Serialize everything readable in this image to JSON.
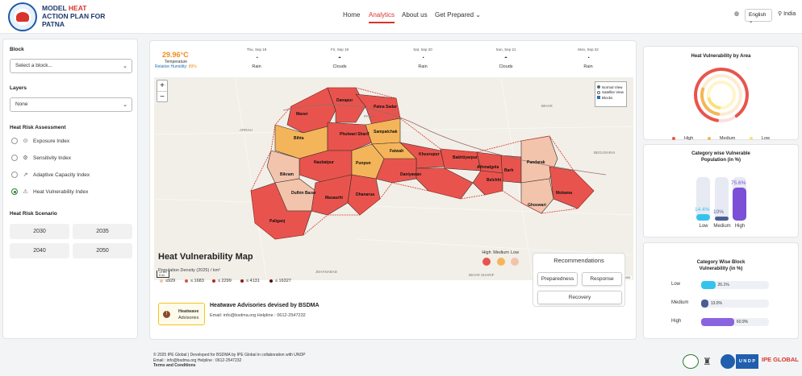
{
  "header": {
    "logo_line1_a": "MODEL ",
    "logo_line1_b": "HEAT",
    "logo_line2": "ACTION PLAN FOR",
    "logo_line3": "PATNA",
    "nav": [
      "Home",
      "Analytics",
      "About us",
      "Get Prepared"
    ],
    "active_nav": "Analytics",
    "language": "English",
    "country": "India"
  },
  "sidebar": {
    "block_label": "Block",
    "block_placeholder": "Select a block...",
    "layers_label": "Layers",
    "layers_value": "None",
    "assessment_label": "Heat Risk Assessment",
    "assessment_options": [
      "Exposure Index",
      "Sensitivity Index",
      "Adaptive Capacity Index",
      "Heat Vulnerability Index"
    ],
    "assessment_selected": "Heat Vulnerability Index",
    "scenario_label": "Heat Risk Scenario",
    "years": [
      "2030",
      "2035",
      "2040",
      "2050"
    ]
  },
  "weather": {
    "temperature": "29.96°C",
    "temperature_label": "Temperature",
    "humidity_label": "Relative Humidity:",
    "humidity_value": "89%",
    "forecast": [
      {
        "date": "Thu, Sep 18",
        "cond": "Rain"
      },
      {
        "date": "Fri, Sep 19",
        "cond": "Clouds"
      },
      {
        "date": "Sat, Sep 20",
        "cond": "Rain"
      },
      {
        "date": "Sun, Sep 21",
        "cond": "Clouds"
      },
      {
        "date": "Mon, Sep 22",
        "cond": "Rain"
      }
    ]
  },
  "map": {
    "layer_options": [
      "Normal View",
      "Satellite View",
      "Blocks"
    ],
    "attribution": "Leaflet | © OpenStreetMap © CartoDB",
    "scale": [
      "10 km",
      "5 mi"
    ],
    "block_labels": [
      "Maner",
      "Danapur",
      "Patna Sadar",
      "Bihta",
      "Phulwari Sharif",
      "Sampatchak",
      "Naubatpur",
      "Punpun",
      "Fatwah",
      "Bikram",
      "Khusrupur",
      "Bakhtiyarpur",
      "Dulhin Bazar",
      "Masaurhi",
      "Dhanarua",
      "Daniyawan",
      "Athmalgola",
      "Barh",
      "Belchhi",
      "Pandarak",
      "Mokama",
      "Ghoswari",
      "Paliganj"
    ],
    "place_labels": [
      "ARRAH",
      "BIHAR",
      "BEGUSARAI",
      "JEHANABAD",
      "BIHAR SHARIF",
      "PATNA"
    ]
  },
  "vuln_map": {
    "title": "Heat Vulnerability Map",
    "pop_density": "Population Density (2025) / km²",
    "density_classes": [
      "≤929",
      "≤ 1683",
      "≤ 2299",
      "≤ 4131",
      "≤ 16327"
    ],
    "legend": [
      "High",
      "Medium",
      "Low"
    ],
    "colors": {
      "high": "#e8544d",
      "medium": "#f4b55a",
      "low": "#f2c4ac"
    }
  },
  "advisory": {
    "box_title": "Heatwave",
    "box_sub": "Advisories",
    "title": "Heatwave Advisories devised by BSDMA",
    "contact": "Email: info@bsdma.org Helpline : 0612-2547232"
  },
  "recommendations": {
    "title": "Recommendations",
    "buttons": [
      "Preparedness",
      "Response",
      "Recovery"
    ]
  },
  "area_card": {
    "title": "Heat Vulnerability by Area",
    "legend": [
      "High",
      "Medium",
      "Low"
    ]
  },
  "population_card": {
    "title_line1": "Category wise Vulnerable",
    "title_line2": "Population (in %)",
    "bars": [
      {
        "label": "Low",
        "value": 14.4,
        "text": "14.4%",
        "color": "#35c3ee"
      },
      {
        "label": "Medium",
        "value": 10,
        "text": "10%",
        "color": "#4b5d93"
      },
      {
        "label": "High",
        "value": 75.6,
        "text": "75.6%",
        "color": "#7b4fd6"
      }
    ]
  },
  "block_card": {
    "title_line1": "Category Wise Block",
    "title_line2": "Vulnerability (in %)",
    "bars": [
      {
        "label": "Low",
        "value": 26.1,
        "text": "26.1%",
        "color": "#35c3ee"
      },
      {
        "label": "Medium",
        "value": 13.0,
        "text": "13.0%",
        "color": "#4b5d93"
      },
      {
        "label": "High",
        "value": 60.9,
        "text": "60.9%",
        "color": "#8a63e0"
      }
    ]
  },
  "footer": {
    "line1": "© 2025 IPE Global | Developed for BSDMA by IPE Global in collaboration with UNDP",
    "line2": "Email : info@bsdma.org Helpline : 0612-2547232",
    "line3": "Terms and Conditions",
    "logo_undp": "U N D P",
    "logo_ipe": "IPE GLOBAL"
  }
}
